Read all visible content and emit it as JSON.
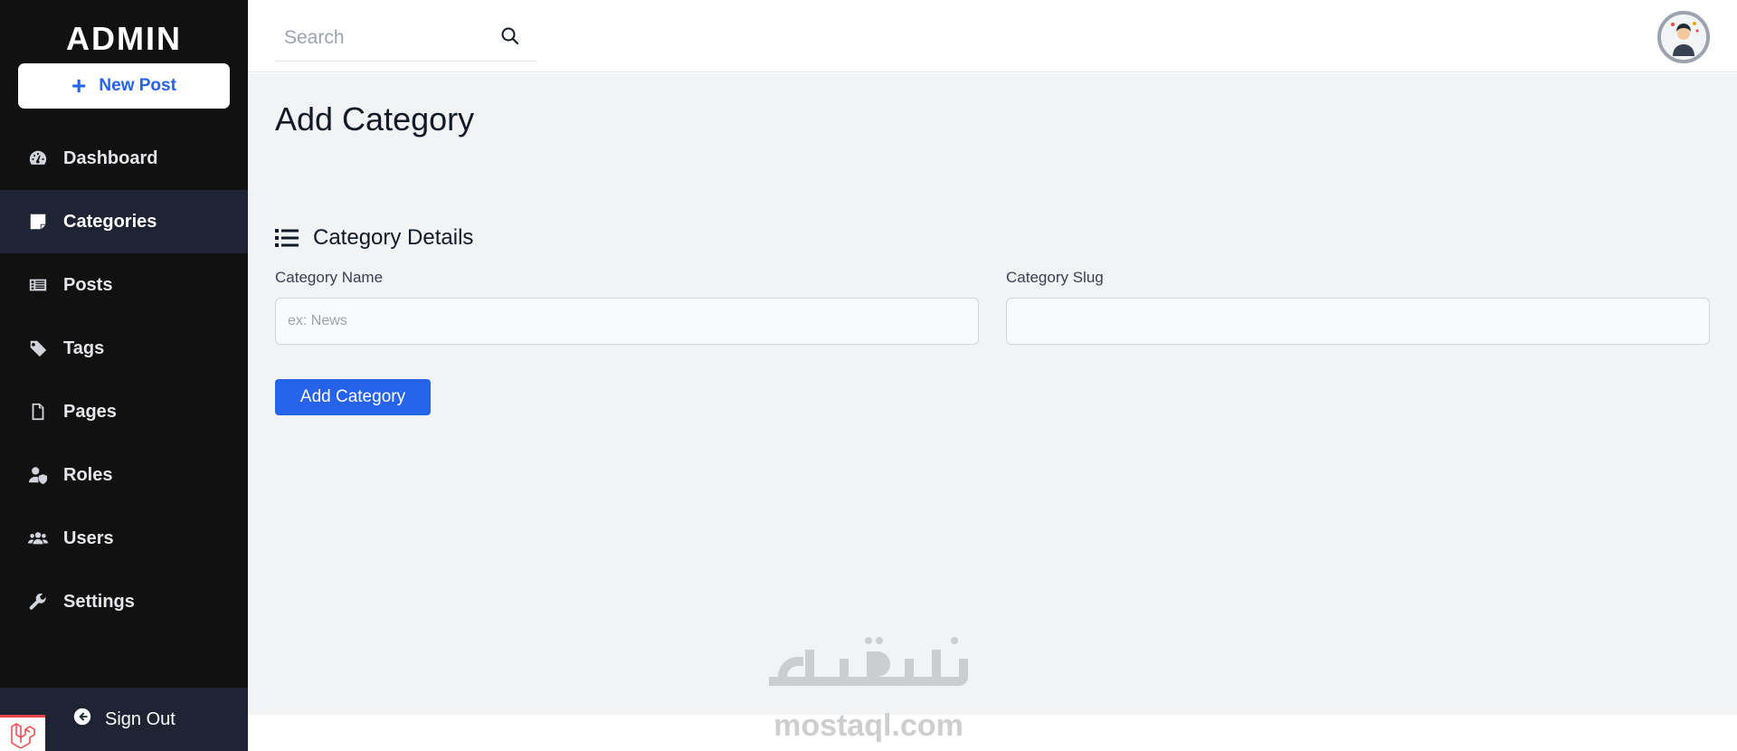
{
  "sidebar": {
    "brand": "ADMIN",
    "new_post_label": "New Post",
    "items": [
      {
        "label": "Dashboard",
        "icon": "gauge-icon"
      },
      {
        "label": "Categories",
        "icon": "sticky-note-icon",
        "active": true
      },
      {
        "label": "Posts",
        "icon": "list-card-icon"
      },
      {
        "label": "Tags",
        "icon": "tag-icon"
      },
      {
        "label": "Pages",
        "icon": "file-icon"
      },
      {
        "label": "Roles",
        "icon": "user-shield-icon"
      },
      {
        "label": "Users",
        "icon": "users-icon"
      },
      {
        "label": "Settings",
        "icon": "wrench-icon"
      }
    ],
    "signout_label": "Sign Out"
  },
  "topbar": {
    "search_placeholder": "Search"
  },
  "main": {
    "page_title": "Add Category",
    "section_title": "Category Details",
    "name_label": "Category Name",
    "name_placeholder": "ex: News",
    "slug_label": "Category Slug",
    "slug_value": "",
    "submit_label": "Add Category"
  },
  "watermark": {
    "arabic": "مستقل",
    "latin": "mostaql.com"
  },
  "colors": {
    "sidebar_bg": "#111111",
    "active_bg": "#1e2433",
    "accent": "#2563eb",
    "content_bg": "#f2f3f5"
  }
}
